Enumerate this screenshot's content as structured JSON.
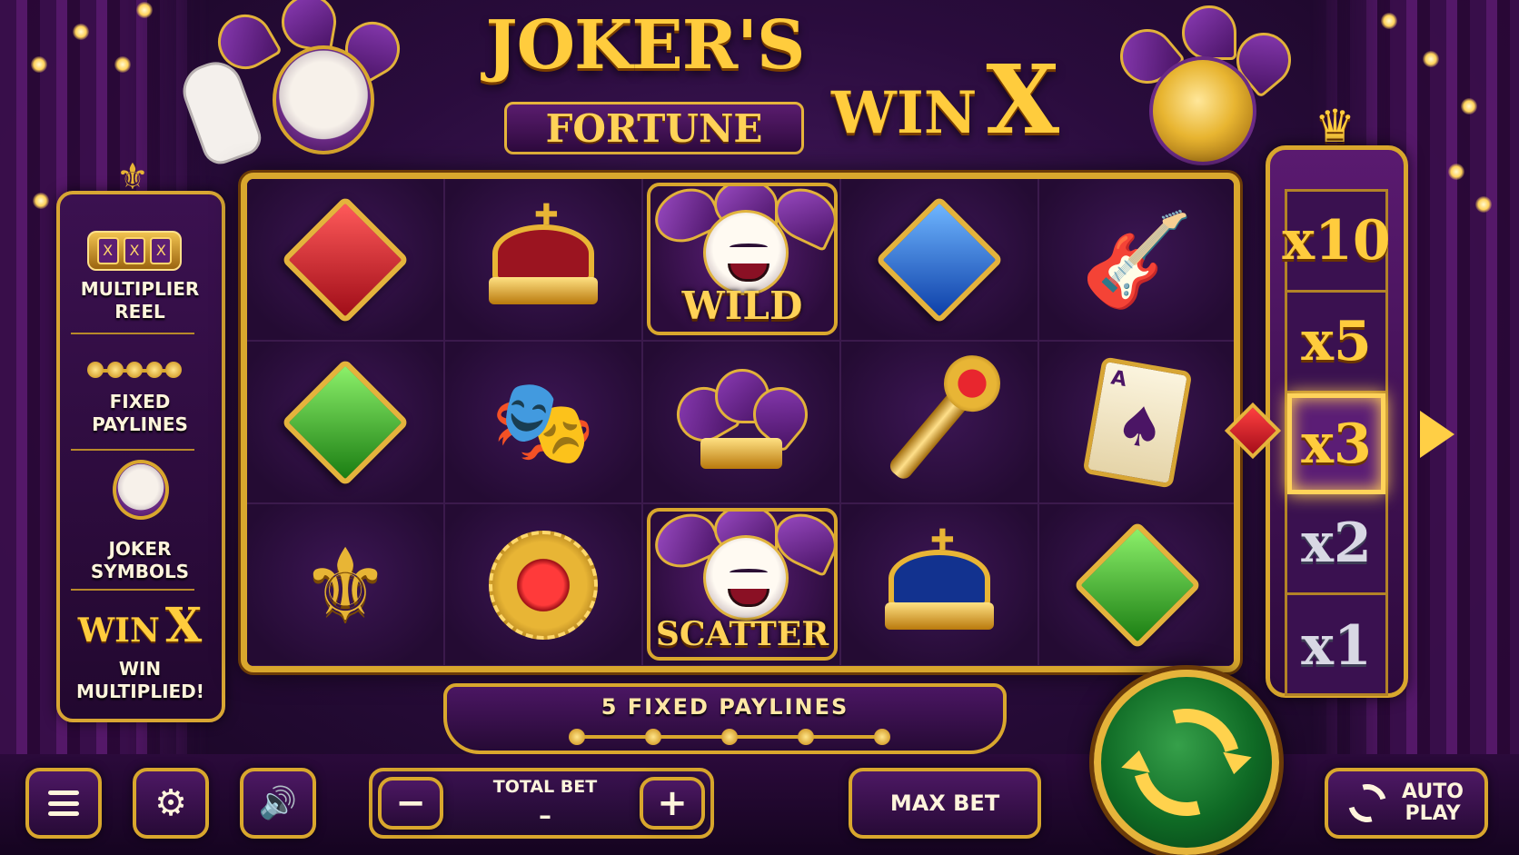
{
  "header": {
    "title_line1": "JOKER'S",
    "title_line2": "FORTUNE",
    "winx_win": "WIN",
    "winx_x": "X"
  },
  "features": {
    "multiplier_reel": "MULTIPLIER REEL",
    "fixed_paylines": "FIXED PAYLINES",
    "joker_symbols": "JOKER SYMBOLS",
    "winx_win": "WIN",
    "winx_x": "X",
    "win_multiplied": "WIN MULTIPLIED!",
    "mini_reel_glyph": "X"
  },
  "reels": {
    "grid": [
      [
        "red-diamond",
        "red-crown",
        "wild-jester",
        "blue-diamond",
        "gold-guitar"
      ],
      [
        "green-diamond",
        "theatre-masks",
        "jester-hat",
        "ruby-scepter",
        "ace-of-spades"
      ],
      [
        "gold-fleur-de-lis",
        "ruby-brooch",
        "scatter-jester",
        "blue-crown",
        "green-diamond"
      ]
    ],
    "wild_label": "WILD",
    "scatter_label": "SCATTER",
    "card_rank": "A",
    "card_suit": "♠",
    "mask_glyph": "🎭",
    "guitar_glyph": "🎸",
    "fleur_glyph": "⚜",
    "cross_glyph": "✚"
  },
  "paylines": {
    "label": "5 FIXED PAYLINES",
    "count": 5
  },
  "multiplier_reel": {
    "values": [
      "x10",
      "x5",
      "x3",
      "x2",
      "x1"
    ],
    "active": "x3",
    "crown_glyph": "♛"
  },
  "controls": {
    "total_bet_label": "TOTAL BET",
    "total_bet_value": "–",
    "minus": "−",
    "plus": "+",
    "max_bet": "MAX BET",
    "auto_play": "AUTO PLAY",
    "settings_glyph": "⚙",
    "sound_glyph": "🔊"
  },
  "colors": {
    "gold": "#d9a72d",
    "purple": "#3b1150",
    "green_spin": "#0f6a25",
    "red_gem": "#e8262e",
    "blue_gem": "#1d6fe0",
    "green_gem": "#3fbf2a"
  }
}
